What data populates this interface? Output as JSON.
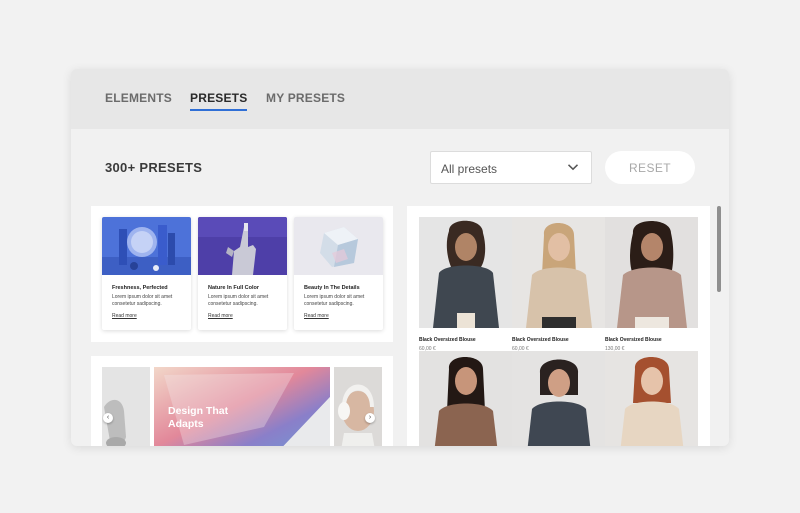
{
  "tabs": [
    {
      "label": "ELEMENTS",
      "active": false
    },
    {
      "label": "PRESETS",
      "active": true
    },
    {
      "label": "MY PRESETS",
      "active": false
    }
  ],
  "toolbar": {
    "count_label": "300+ PRESETS",
    "filter_selected": "All presets",
    "reset_label": "RESET"
  },
  "features": [
    {
      "title": "Freshness, Perfected",
      "description": "Lorem ipsum dolor sit amet consetetur sadipscing.",
      "link": "Read more"
    },
    {
      "title": "Nature In Full Color",
      "description": "Lorem ipsum dolor sit amet consetetur sadipscing.",
      "link": "Read more"
    },
    {
      "title": "Beauty In The Details",
      "description": "Lorem ipsum dolor sit amet consetetur sadipscing.",
      "link": "Read more"
    }
  ],
  "slider": {
    "caption": "Design That Adapts",
    "prev_glyph": "‹",
    "next_glyph": "›"
  },
  "products": [
    {
      "name": "Black Oversized Blouse",
      "price": "60,00 €"
    },
    {
      "name": "Black Oversized Blouse",
      "price": "60,00 €"
    },
    {
      "name": "Black Oversized Blouse",
      "price": "130,00 €"
    },
    {
      "name": "",
      "price": ""
    },
    {
      "name": "",
      "price": ""
    },
    {
      "name": "",
      "price": ""
    }
  ],
  "colors": {
    "accent": "#2f6fd6",
    "panel": "#f1f1f1",
    "tabbar": "#e7e7e7"
  }
}
